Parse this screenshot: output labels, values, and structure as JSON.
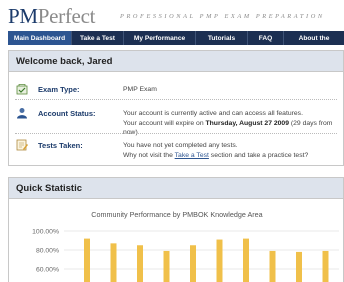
{
  "header": {
    "logo_pm": "PM",
    "logo_perfect": "Perfect",
    "tagline": "PROFESSIONAL PMP EXAM PREPARATION"
  },
  "nav": {
    "items": [
      {
        "label": "Main Dashboard",
        "active": true
      },
      {
        "label": "Take a Test",
        "active": false
      },
      {
        "label": "My Performance",
        "active": false
      },
      {
        "label": "Tutorials",
        "active": false
      },
      {
        "label": "FAQ",
        "active": false
      },
      {
        "label": "About the",
        "active": false
      }
    ]
  },
  "welcome": {
    "title": "Welcome back, Jared",
    "exam_type_label": "Exam Type:",
    "exam_type_value": "PMP Exam",
    "account_label": "Account Status:",
    "account_line1": "Your account is currently active and can access all features.",
    "account_line2_prefix": "Your account will expire on ",
    "account_expiry": "Thursday, August 27 2009",
    "account_line2_suffix": " (29 days from now)",
    "tests_label": "Tests Taken:",
    "tests_line1": "You have not yet completed any tests.",
    "tests_line2_prefix": "Why not visit the ",
    "tests_link": "Take a Test",
    "tests_line2_suffix": " section and take a practice test?"
  },
  "stats": {
    "title": "Quick Statistic"
  },
  "colors": {
    "nav_bg": "#1c2f52",
    "nav_active": "#2d5591",
    "bar": "#f0c04a",
    "panel_head": "#dde3ec"
  },
  "chart_data": {
    "type": "bar",
    "title": "Community Performance by PMBOK Knowledge Area",
    "ylim": [
      60,
      100
    ],
    "yticks": [
      "100.00%",
      "80.00%",
      "60.00%"
    ],
    "ytick_values": [
      100,
      80,
      60
    ],
    "values": [
      92,
      87,
      85,
      79,
      85,
      91,
      92,
      79,
      78,
      79
    ],
    "grid": true
  }
}
